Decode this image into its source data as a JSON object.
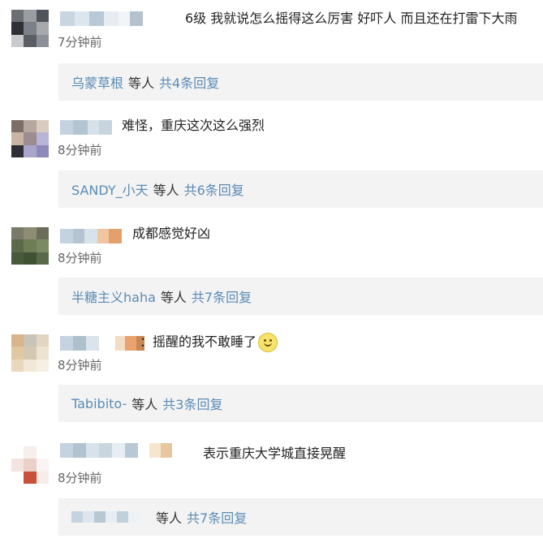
{
  "comments": [
    {
      "text": "6级 我就说怎么摇得这么厉害 好吓人 而且还在打雷下大雨",
      "time": "7分钟前",
      "reply": {
        "user": "乌蒙草根",
        "mid": "等人",
        "count": "共4条回复"
      }
    },
    {
      "text": "难怪，重庆这次这么强烈",
      "time": "8分钟前",
      "reply": {
        "user": "SANDY_小天",
        "mid": "等人",
        "count": "共6条回复"
      }
    },
    {
      "text": "成都感觉好凶",
      "time": "8分钟前",
      "reply": {
        "user": "半糖主义haha",
        "mid": "等人",
        "count": "共7条回复"
      }
    },
    {
      "text": "：摇醒的我不敢睡了",
      "emoji": "smile-emoji",
      "time": "8分钟前",
      "reply": {
        "user": "Tabibito-",
        "mid": "等人",
        "count": "共3条回复"
      }
    },
    {
      "text": "表示重庆大学城直接晃醒",
      "time": "8分钟前",
      "reply": {
        "user": "",
        "mid": "等人",
        "count": "共7条回复"
      }
    }
  ],
  "colors": {
    "link": "#5b8bb5",
    "reply_bg": "#f3f3f3",
    "time": "#666666"
  }
}
